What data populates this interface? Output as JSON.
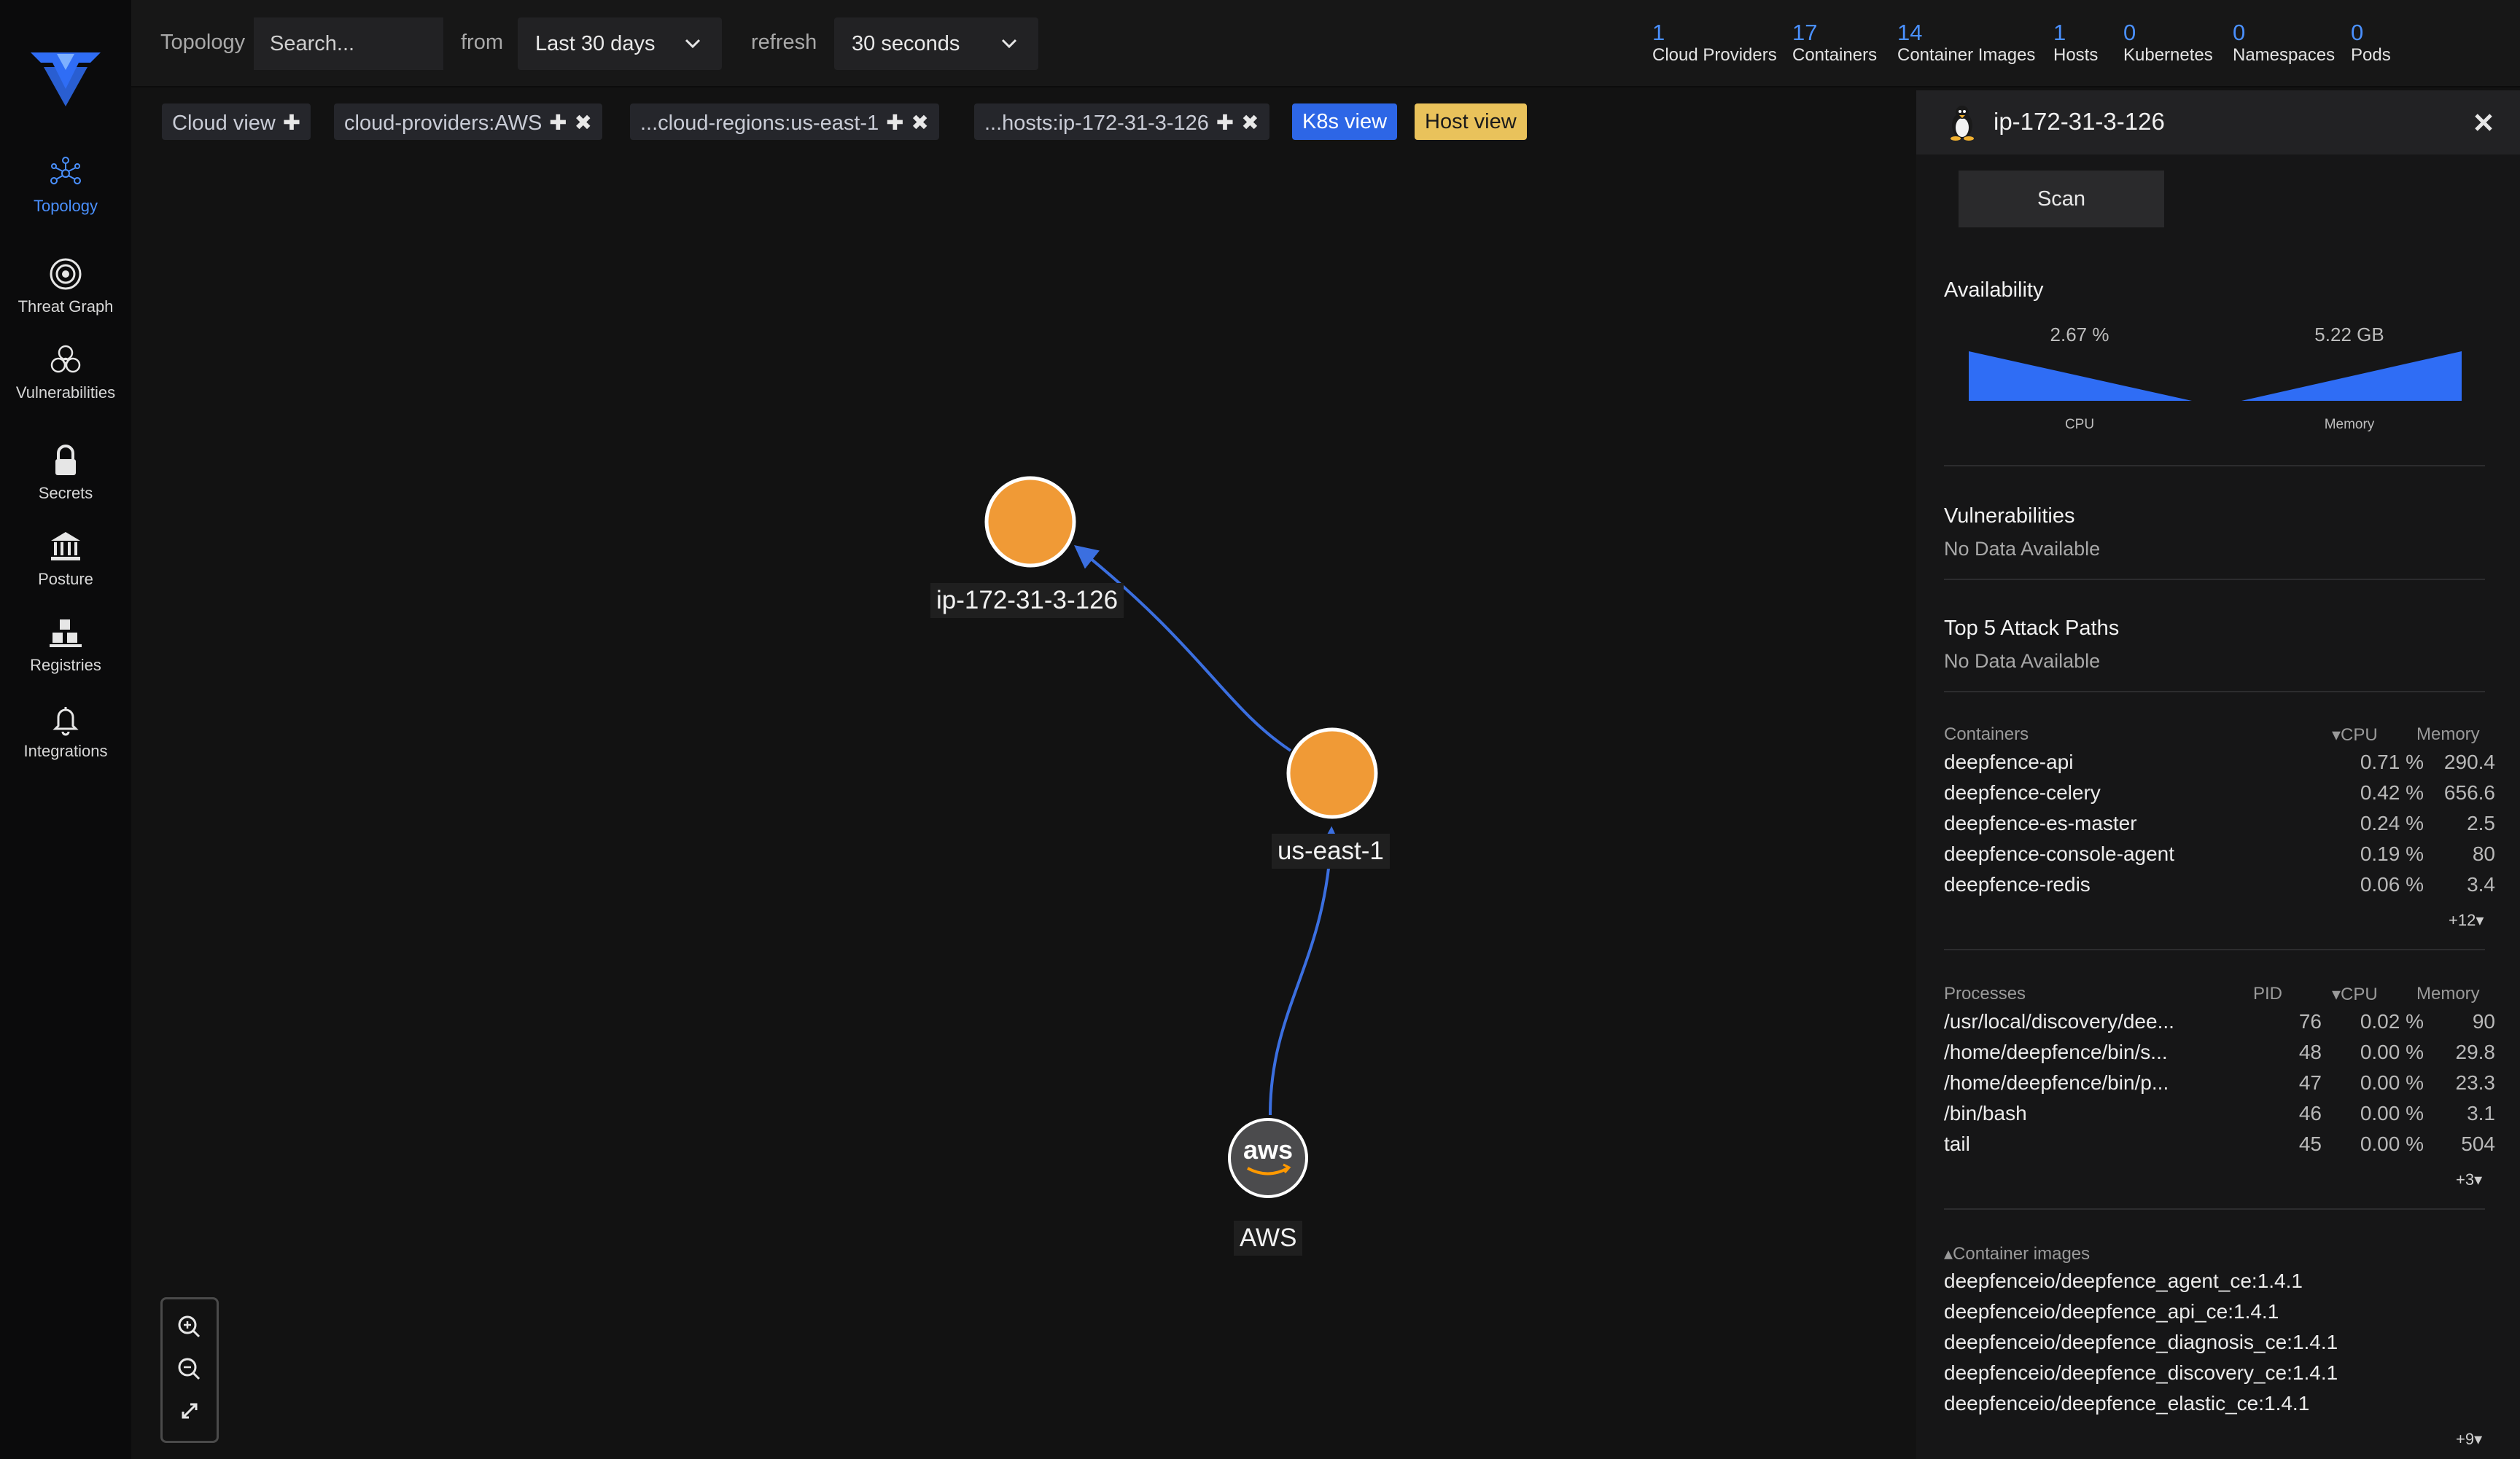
{
  "colors": {
    "accent": "#4a90ff",
    "node": "#f09a36",
    "k8s_chip": "#2d66e6",
    "host_chip": "#e9c25b",
    "chart_fill": "#2f6df5"
  },
  "sidebar": {
    "items": [
      {
        "label": "Topology",
        "icon": "topology-icon",
        "active": true
      },
      {
        "label": "Threat Graph",
        "icon": "threat-graph-icon"
      },
      {
        "label": "Vulnerabilities",
        "icon": "biohazard-icon"
      },
      {
        "label": "Secrets",
        "icon": "lock-icon"
      },
      {
        "label": "Posture",
        "icon": "bank-icon"
      },
      {
        "label": "Registries",
        "icon": "registries-icon"
      },
      {
        "label": "Integrations",
        "icon": "bell-icon"
      }
    ]
  },
  "topbar": {
    "title": "Topology",
    "search_placeholder": "Search...",
    "from_label": "from",
    "time_range": "Last 30 days",
    "refresh_label": "refresh",
    "refresh_interval": "30 seconds",
    "stats": [
      {
        "value": "1",
        "label": "Cloud Providers"
      },
      {
        "value": "17",
        "label": "Containers"
      },
      {
        "value": "14",
        "label": "Container Images"
      },
      {
        "value": "1",
        "label": "Hosts"
      },
      {
        "value": "0",
        "label": "Kubernetes"
      },
      {
        "value": "0",
        "label": "Namespaces"
      },
      {
        "value": "0",
        "label": "Pods"
      }
    ]
  },
  "filters": {
    "chips": [
      {
        "label": "Cloud view",
        "add": "✚"
      },
      {
        "label": "cloud-providers:AWS",
        "add": "✚",
        "remove": "✖"
      },
      {
        "label": "...cloud-regions:us-east-1",
        "add": "✚",
        "remove": "✖"
      },
      {
        "label": "...hosts:ip-172-31-3-126",
        "add": "✚",
        "remove": "✖"
      }
    ],
    "k8s_view": "K8s view",
    "host_view": "Host view"
  },
  "graph": {
    "nodes": [
      {
        "label": "ip-172-31-3-126",
        "type": "host"
      },
      {
        "label": "us-east-1",
        "type": "region"
      },
      {
        "label": "AWS",
        "type": "cloud-provider",
        "logo_text": "aws"
      }
    ]
  },
  "panel": {
    "title": "ip-172-31-3-126",
    "os_icon": "linux-penguin-icon",
    "scan_label": "Scan",
    "availability": {
      "title": "Availability",
      "cpu_value": "2.67 %",
      "cpu_label": "CPU",
      "memory_value": "5.22 GB",
      "memory_label": "Memory"
    },
    "vulnerabilities": {
      "title": "Vulnerabilities",
      "status": "No Data Available"
    },
    "attack_paths": {
      "title": "Top 5 Attack Paths",
      "status": "No Data Available"
    },
    "containers": {
      "header_name": "Containers",
      "header_cpu": "CPU",
      "header_memory": "Memory",
      "rows": [
        {
          "name": "deepfence-api",
          "cpu": "0.71 %",
          "memory": "290.4"
        },
        {
          "name": "deepfence-celery",
          "cpu": "0.42 %",
          "memory": "656.6"
        },
        {
          "name": "deepfence-es-master",
          "cpu": "0.24 %",
          "memory": "2.5"
        },
        {
          "name": "deepfence-console-agent",
          "cpu": "0.19 %",
          "memory": "80"
        },
        {
          "name": "deepfence-redis",
          "cpu": "0.06 %",
          "memory": "3.4"
        }
      ],
      "more": "+12"
    },
    "processes": {
      "header_name": "Processes",
      "header_pid": "PID",
      "header_cpu": "CPU",
      "header_memory": "Memory",
      "rows": [
        {
          "name": "/usr/local/discovery/dee...",
          "pid": "76",
          "cpu": "0.02 %",
          "memory": "90"
        },
        {
          "name": "/home/deepfence/bin/s...",
          "pid": "48",
          "cpu": "0.00 %",
          "memory": "29.8"
        },
        {
          "name": "/home/deepfence/bin/p...",
          "pid": "47",
          "cpu": "0.00 %",
          "memory": "23.3"
        },
        {
          "name": "/bin/bash",
          "pid": "46",
          "cpu": "0.00 %",
          "memory": "3.1"
        },
        {
          "name": "tail",
          "pid": "45",
          "cpu": "0.00 %",
          "memory": "504"
        }
      ],
      "more": "+3"
    },
    "container_images": {
      "header": "Container images",
      "rows": [
        "deepfenceio/deepfence_agent_ce:1.4.1",
        "deepfenceio/deepfence_api_ce:1.4.1",
        "deepfenceio/deepfence_diagnosis_ce:1.4.1",
        "deepfenceio/deepfence_discovery_ce:1.4.1",
        "deepfenceio/deepfence_elastic_ce:1.4.1"
      ],
      "more": "+9"
    }
  }
}
